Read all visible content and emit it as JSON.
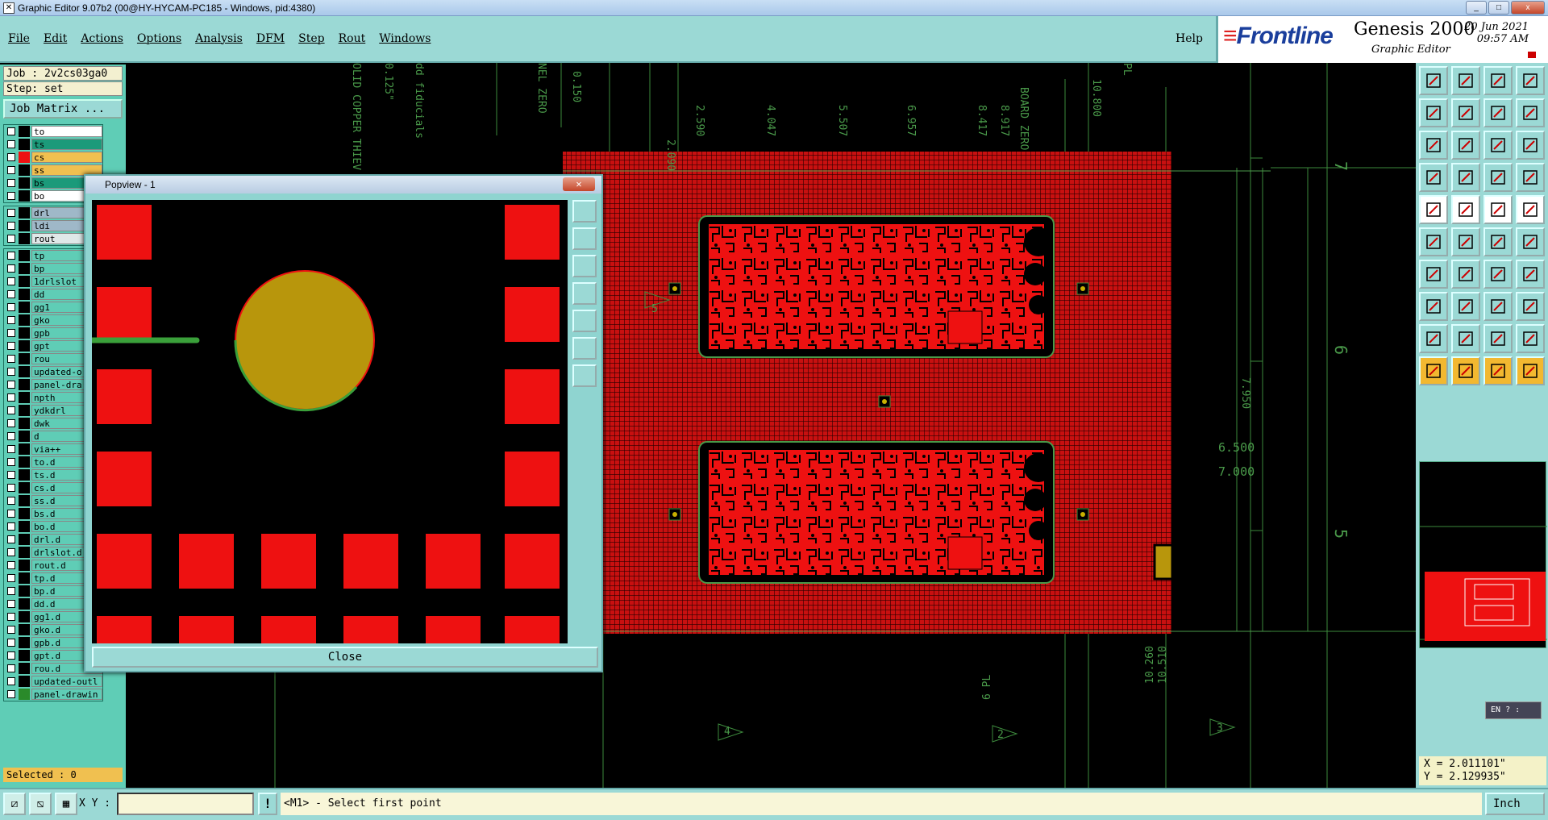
{
  "window": {
    "title": "Graphic Editor 9.07b2 (00@HY-HYCAM-PC185 - Windows, pid:4380)",
    "controls": [
      "_",
      "□",
      "x"
    ]
  },
  "menu": {
    "items": [
      "File",
      "Edit",
      "Actions",
      "Options",
      "Analysis",
      "DFM",
      "Step",
      "Rout",
      "Windows"
    ],
    "help": "Help"
  },
  "brand": {
    "logo": "Frontline",
    "product": "Genesis 2000",
    "subtitle": "Graphic Editor",
    "date": "20 Jun 2021",
    "time": "09:57 AM"
  },
  "job": {
    "job_label": "Job : 2v2cs03ga0",
    "step_label": "Step: set",
    "matrix_button": "Job Matrix ..."
  },
  "layer_groups": [
    [
      {
        "name": "to",
        "color": "#ffffff",
        "swatch": "#000000"
      },
      {
        "name": "ts",
        "color": "#1b9a7a",
        "swatch": "#000000"
      },
      {
        "name": "cs",
        "color": "#f0c050",
        "swatch": "#ee1111"
      },
      {
        "name": "ss",
        "color": "#f0c050",
        "swatch": "#000000"
      },
      {
        "name": "bs",
        "color": "#1b9a7a",
        "swatch": "#000000"
      },
      {
        "name": "bo",
        "color": "#ffffff",
        "swatch": "#000000"
      }
    ],
    [
      {
        "name": "drl",
        "color": "#9fb8c8",
        "swatch": "#000000"
      },
      {
        "name": "ldi",
        "color": "#9fb8c8",
        "swatch": "#000000"
      },
      {
        "name": "rout",
        "color": "#dfe8e8",
        "swatch": "#000000"
      }
    ],
    [
      {
        "name": "tp",
        "color": "#5fcdb6",
        "swatch": "#000000"
      },
      {
        "name": "bp",
        "color": "#5fcdb6",
        "swatch": "#000000"
      },
      {
        "name": "1drlslot",
        "color": "#5fcdb6",
        "swatch": "#000000"
      },
      {
        "name": "dd",
        "color": "#5fcdb6",
        "swatch": "#000000"
      },
      {
        "name": "gg1",
        "color": "#5fcdb6",
        "swatch": "#000000"
      },
      {
        "name": "gko",
        "color": "#5fcdb6",
        "swatch": "#000000"
      },
      {
        "name": "gpb",
        "color": "#5fcdb6",
        "swatch": "#000000"
      },
      {
        "name": "gpt",
        "color": "#5fcdb6",
        "swatch": "#000000"
      },
      {
        "name": "rou",
        "color": "#5fcdb6",
        "swatch": "#000000"
      },
      {
        "name": "updated-o",
        "color": "#5fcdb6",
        "swatch": "#000000"
      },
      {
        "name": "panel-dra",
        "color": "#5fcdb6",
        "swatch": "#000000"
      },
      {
        "name": "npth",
        "color": "#5fcdb6",
        "swatch": "#000000"
      },
      {
        "name": "ydkdrl",
        "color": "#5fcdb6",
        "swatch": "#000000"
      },
      {
        "name": "dwk",
        "color": "#5fcdb6",
        "swatch": "#000000"
      },
      {
        "name": "d",
        "color": "#5fcdb6",
        "swatch": "#000000"
      },
      {
        "name": "via++",
        "color": "#5fcdb6",
        "swatch": "#000000"
      },
      {
        "name": "to.d",
        "color": "#5fcdb6",
        "swatch": "#000000"
      },
      {
        "name": "ts.d",
        "color": "#5fcdb6",
        "swatch": "#000000"
      },
      {
        "name": "cs.d",
        "color": "#5fcdb6",
        "swatch": "#000000"
      },
      {
        "name": "ss.d",
        "color": "#5fcdb6",
        "swatch": "#000000"
      },
      {
        "name": "bs.d",
        "color": "#5fcdb6",
        "swatch": "#000000"
      },
      {
        "name": "bo.d",
        "color": "#5fcdb6",
        "swatch": "#000000"
      },
      {
        "name": "drl.d",
        "color": "#5fcdb6",
        "swatch": "#000000"
      },
      {
        "name": "drlslot.d",
        "color": "#5fcdb6",
        "swatch": "#000000"
      },
      {
        "name": "rout.d",
        "color": "#5fcdb6",
        "swatch": "#000000"
      },
      {
        "name": "tp.d",
        "color": "#5fcdb6",
        "swatch": "#000000"
      },
      {
        "name": "bp.d",
        "color": "#5fcdb6",
        "swatch": "#000000"
      },
      {
        "name": "dd.d",
        "color": "#5fcdb6",
        "swatch": "#000000"
      },
      {
        "name": "gg1.d",
        "color": "#5fcdb6",
        "swatch": "#000000"
      },
      {
        "name": "gko.d",
        "color": "#5fcdb6",
        "swatch": "#000000"
      },
      {
        "name": "gpb.d",
        "color": "#5fcdb6",
        "swatch": "#000000"
      },
      {
        "name": "gpt.d",
        "color": "#5fcdb6",
        "swatch": "#000000"
      },
      {
        "name": "rou.d",
        "color": "#5fcdb6",
        "swatch": "#000000"
      },
      {
        "name": "updated-outl",
        "color": "#5fcdb6",
        "swatch": "#000000"
      },
      {
        "name": "panel-drawin",
        "color": "#5fcdb6",
        "swatch": "#2a8a2a"
      }
    ]
  ],
  "selected": "Selected : 0",
  "popview": {
    "title": "Popview - 1",
    "close_label": "Close"
  },
  "canvas": {
    "dims_top": [
      "2.090",
      "2.590",
      "4.047",
      "5.507",
      "6.957",
      "8.417",
      "8.917",
      "10.800"
    ],
    "labels_top_misc": [
      "0.150",
      "0.125\"",
      "PL",
      "BOARD ZERO",
      "NEL ZERO",
      "dd fiducials",
      "OLID COPPER THIEV"
    ],
    "dims_right": [
      "6.500",
      "7.000",
      "7.950"
    ],
    "dims_bottom": [
      "10.260",
      "10.510",
      "6 PL"
    ],
    "ruler_right": [
      "7",
      "6",
      "5"
    ],
    "callouts": [
      "4",
      "2",
      "3",
      "5"
    ]
  },
  "coords": {
    "x": "X = 2.011101\"",
    "y": "Y = 2.129935\""
  },
  "status": {
    "xy_label": "X Y :",
    "xy_value": "",
    "prompt": "<M1> - Select first point",
    "unit": "Inch",
    "ime": "EN"
  },
  "colors": {
    "panel": "#9bd9d5",
    "layer_bg": "#5fcdb6",
    "copper": "#ee1111",
    "grid": "#3a9a3a",
    "pad": "#b8960c"
  }
}
